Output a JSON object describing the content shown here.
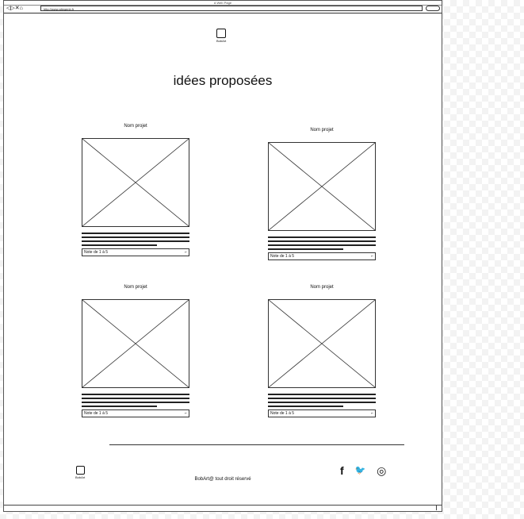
{
  "window": {
    "title": "A Web Page",
    "url": "http://www.sitegenb.fr",
    "nav_glyphs": "◁▷✕⌂"
  },
  "header": {
    "logo_label": "BobArt",
    "title": "idées proposées"
  },
  "projects": [
    {
      "name": "Nom projet",
      "rating_placeholder": "Note de 1 à 5"
    },
    {
      "name": "Nom projet",
      "rating_placeholder": "Note de 1 à 5"
    },
    {
      "name": "Nom projet",
      "rating_placeholder": "Note de 1 à 5"
    },
    {
      "name": "Nom projet",
      "rating_placeholder": "Note de 1 à 5"
    }
  ],
  "footer": {
    "logo_label": "BobArt",
    "copyright": "BobArt@ tout droit réservé",
    "social": [
      {
        "icon": "facebook-icon",
        "glyph": "f"
      },
      {
        "icon": "twitter-icon",
        "glyph": "🐦"
      },
      {
        "icon": "instagram-icon",
        "glyph": "◎"
      }
    ]
  }
}
